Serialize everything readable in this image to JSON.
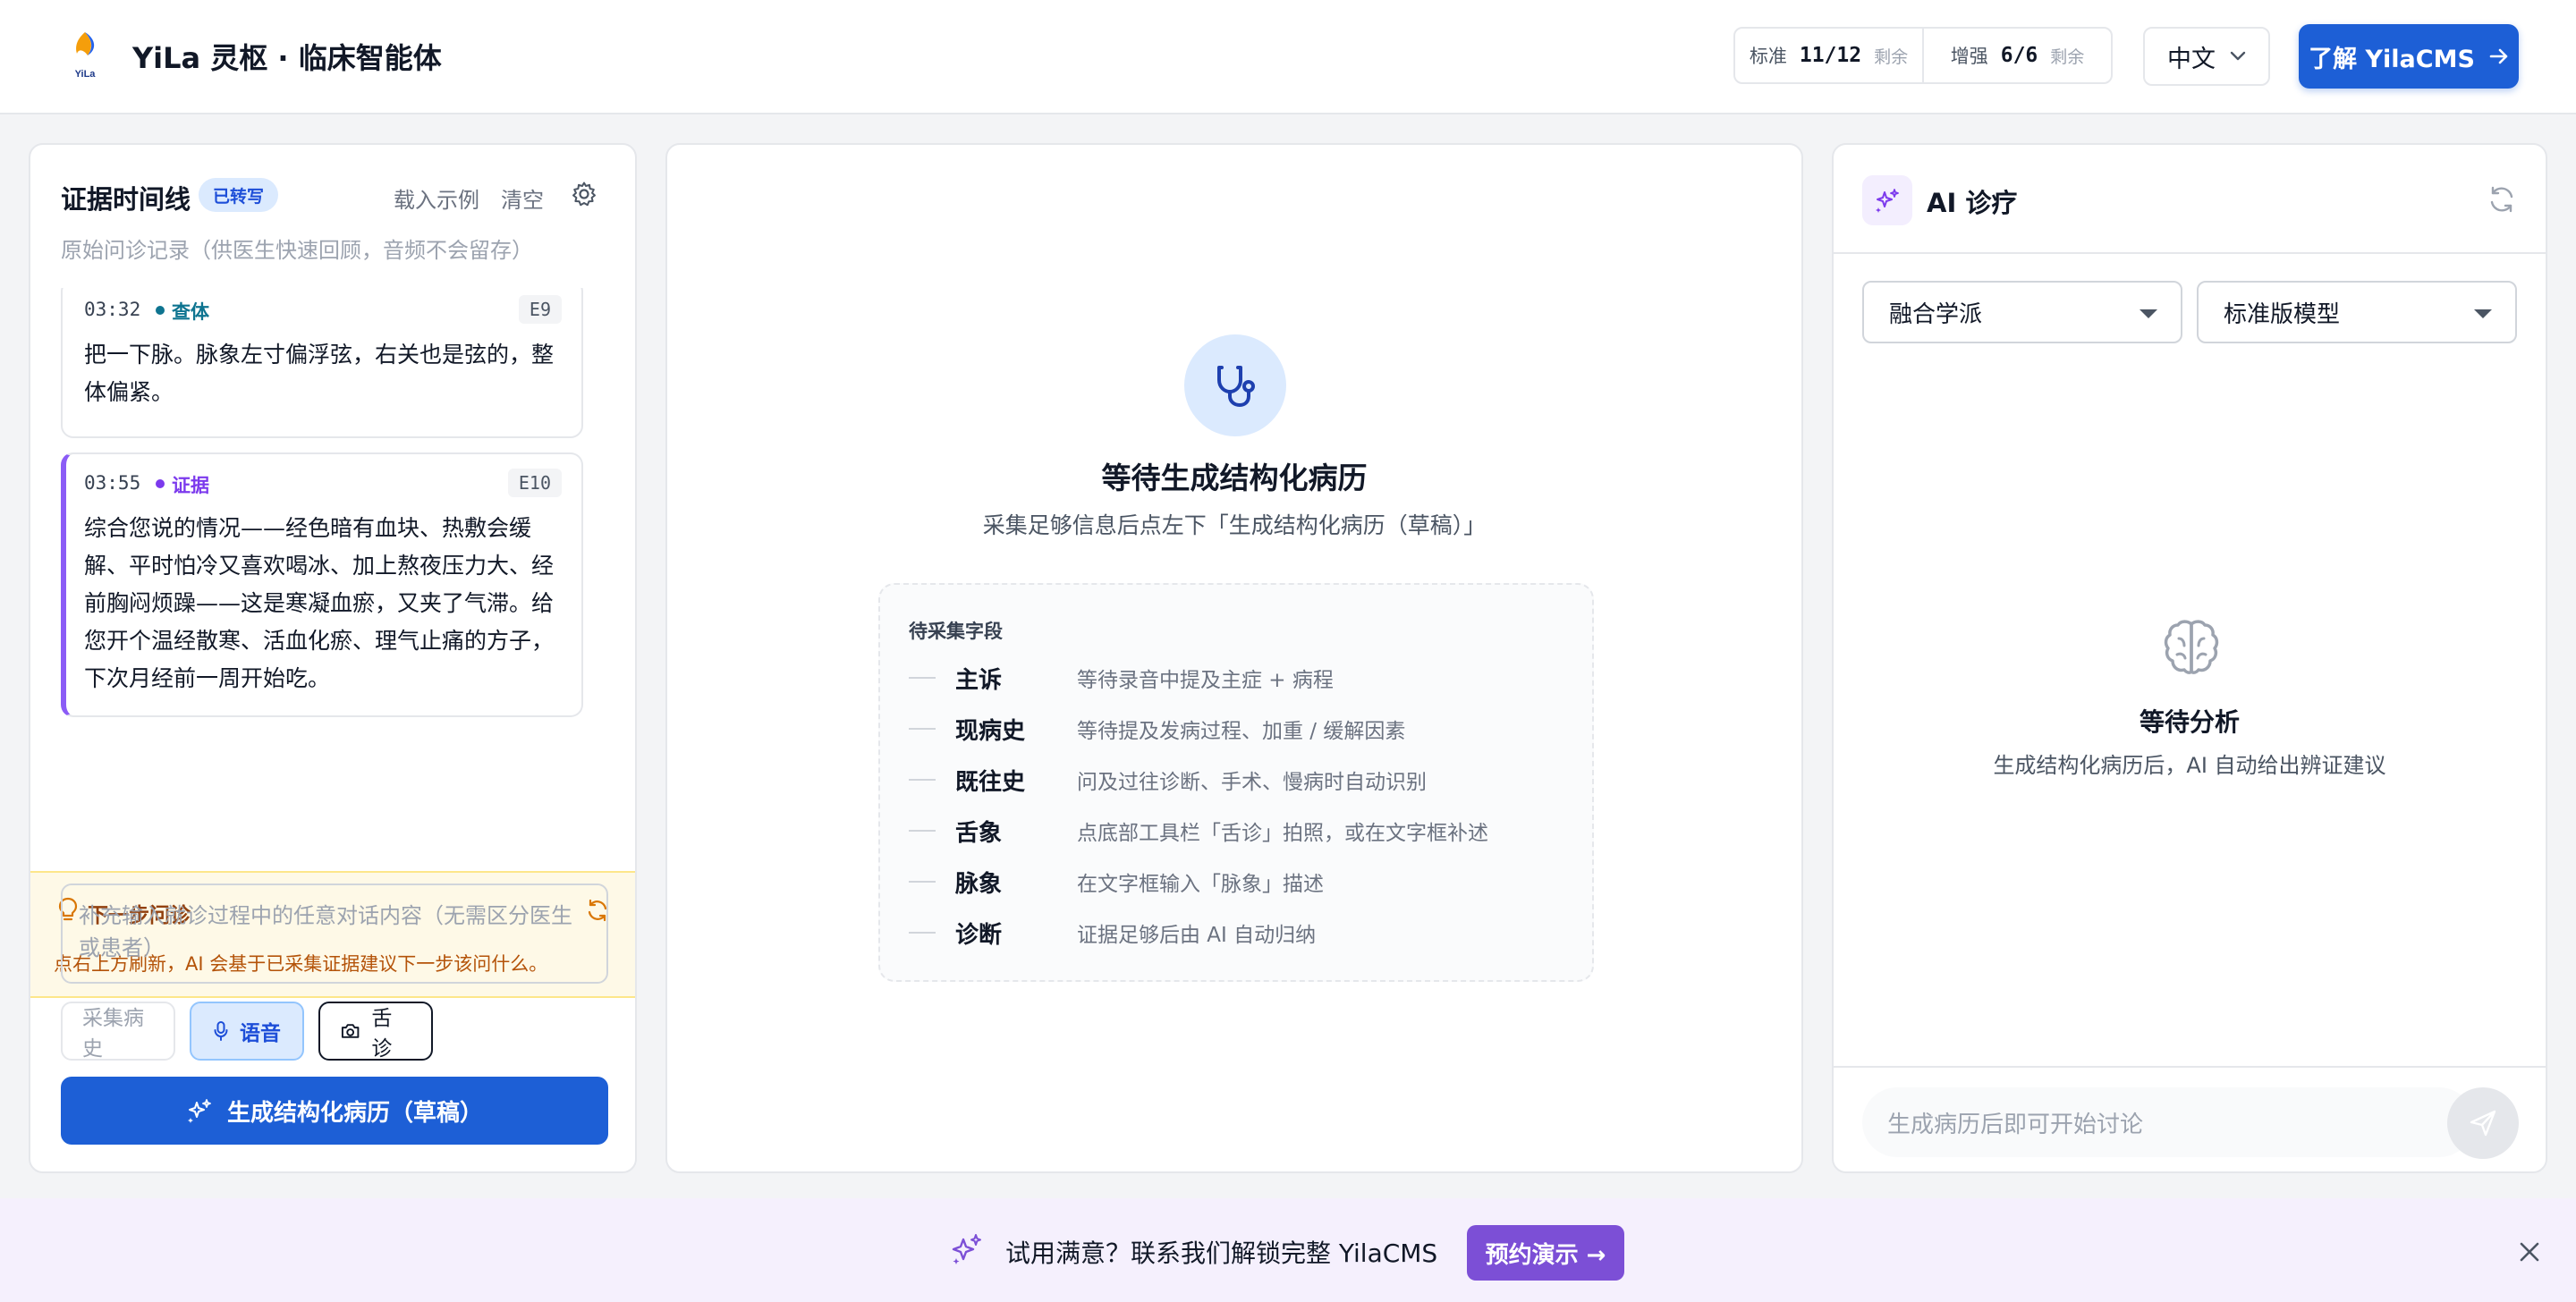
{
  "header": {
    "app_title": "YiLa 灵枢 · 临床智能体",
    "logo_text": "YiLa",
    "quota": [
      {
        "label": "标准",
        "value": "11/12",
        "remaining": "剩余"
      },
      {
        "label": "增强",
        "value": "6/6",
        "remaining": "剩余"
      }
    ],
    "language": "中文",
    "cta_label": "了解 YilaCMS"
  },
  "left_panel": {
    "title": "证据时间线",
    "badge": "已转写",
    "load_example": "载入示例",
    "clear": "清空",
    "subtitle": "原始问诊记录（供医生快速回顾，音频不会留存）",
    "cards": [
      {
        "time": "03:32",
        "type": "查体",
        "type_color": "#0e7490",
        "id": "E9",
        "text": "把一下脉。脉象左寸偏浮弦，右关也是弦的，整体偏紧。"
      },
      {
        "time": "03:55",
        "type": "证据",
        "type_color": "#7c3aed",
        "id": "E10",
        "text": "综合您说的情况——经色暗有血块、热敷会缓解、平时怕冷又喜欢喝冰、加上熬夜压力大、经前胸闷烦躁——这是寒凝血瘀，又夹了气滞。给您开个温经散寒、活血化瘀、理气止痛的方子，下次月经前一周开始吃。"
      }
    ],
    "next_question": {
      "title": "下一步问诊",
      "desc": "点右上方刷新，AI 会基于已采集证据建议下一步该问什么。"
    },
    "input_placeholder": "补充输入就诊过程中的任意对话内容（无需区分医生或患者）",
    "buttons": {
      "history": "采集病史",
      "voice": "语音",
      "tongue": "舌诊"
    },
    "generate_label": "生成结构化病历（草稿）"
  },
  "center_panel": {
    "title": "等待生成结构化病历",
    "subtitle": "采集足够信息后点左下「生成结构化病历（草稿）」",
    "fields_heading": "待采集字段",
    "fields": [
      {
        "name": "主诉",
        "desc": "等待录音中提及主症 + 病程"
      },
      {
        "name": "现病史",
        "desc": "等待提及发病过程、加重 / 缓解因素"
      },
      {
        "name": "既往史",
        "desc": "问及过往诊断、手术、慢病时自动识别"
      },
      {
        "name": "舌象",
        "desc": "点底部工具栏「舌诊」拍照，或在文字框补述"
      },
      {
        "name": "脉象",
        "desc": "在文字框输入「脉象」描述"
      },
      {
        "name": "诊断",
        "desc": "证据足够后由 AI 自动归纳"
      }
    ]
  },
  "right_panel": {
    "title": "AI 诊疗",
    "school_select": "融合学派",
    "model_select": "标准版模型",
    "await_title": "等待分析",
    "await_sub": "生成结构化病历后，AI 自动给出辨证建议",
    "chat_placeholder": "生成病历后即可开始讨论"
  },
  "banner": {
    "text": "试用满意？联系我们解锁完整 YilaCMS",
    "button": "预约演示 →"
  },
  "colors": {
    "primary": "#1d5fd6",
    "purple": "#7c4fd6",
    "warning_bg": "#fef9e7"
  }
}
